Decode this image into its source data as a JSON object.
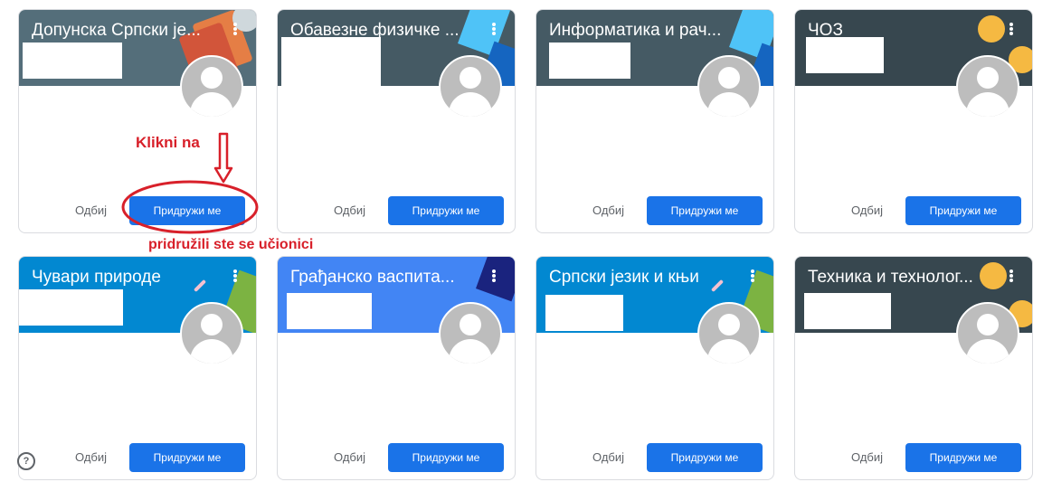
{
  "classes": [
    {
      "title": "Допунска Српски је...",
      "banner_color": "#546e7a",
      "decline": "Одбиј",
      "join": "Придружи ме"
    },
    {
      "title": "Обавезне физичке ...",
      "banner_color": "#455a64",
      "decline": "Одбиј",
      "join": "Придружи ме"
    },
    {
      "title": "Информатика и рач...",
      "banner_color": "#455a64",
      "decline": "Одбиј",
      "join": "Придружи ме"
    },
    {
      "title": "ЧОЗ",
      "banner_color": "#37474f",
      "decline": "Одбиј",
      "join": "Придружи ме"
    },
    {
      "title": "Чувари природе",
      "banner_color": "#0288d1",
      "decline": "Одбиј",
      "join": "Придружи ме"
    },
    {
      "title": "Грађанско васпита...",
      "banner_color": "#4285f4",
      "decline": "Одбиј",
      "join": "Придружи ме"
    },
    {
      "title": "Српски језик и књи",
      "banner_color": "#0288d1",
      "decline": "Одбиј",
      "join": "Придружи ме"
    },
    {
      "title": "Техника и технолог...",
      "banner_color": "#37474f",
      "decline": "Одбиј",
      "join": "Придружи ме"
    }
  ],
  "annotation": {
    "click_text": "Klikni na",
    "joined_text": "pridružili ste se učionici",
    "color": "#d8202a"
  },
  "help_icon": {
    "glyph": "?"
  },
  "icons": [
    "more-vert-icon",
    "avatar-icon",
    "help-icon",
    "arrow-down-icon"
  ]
}
